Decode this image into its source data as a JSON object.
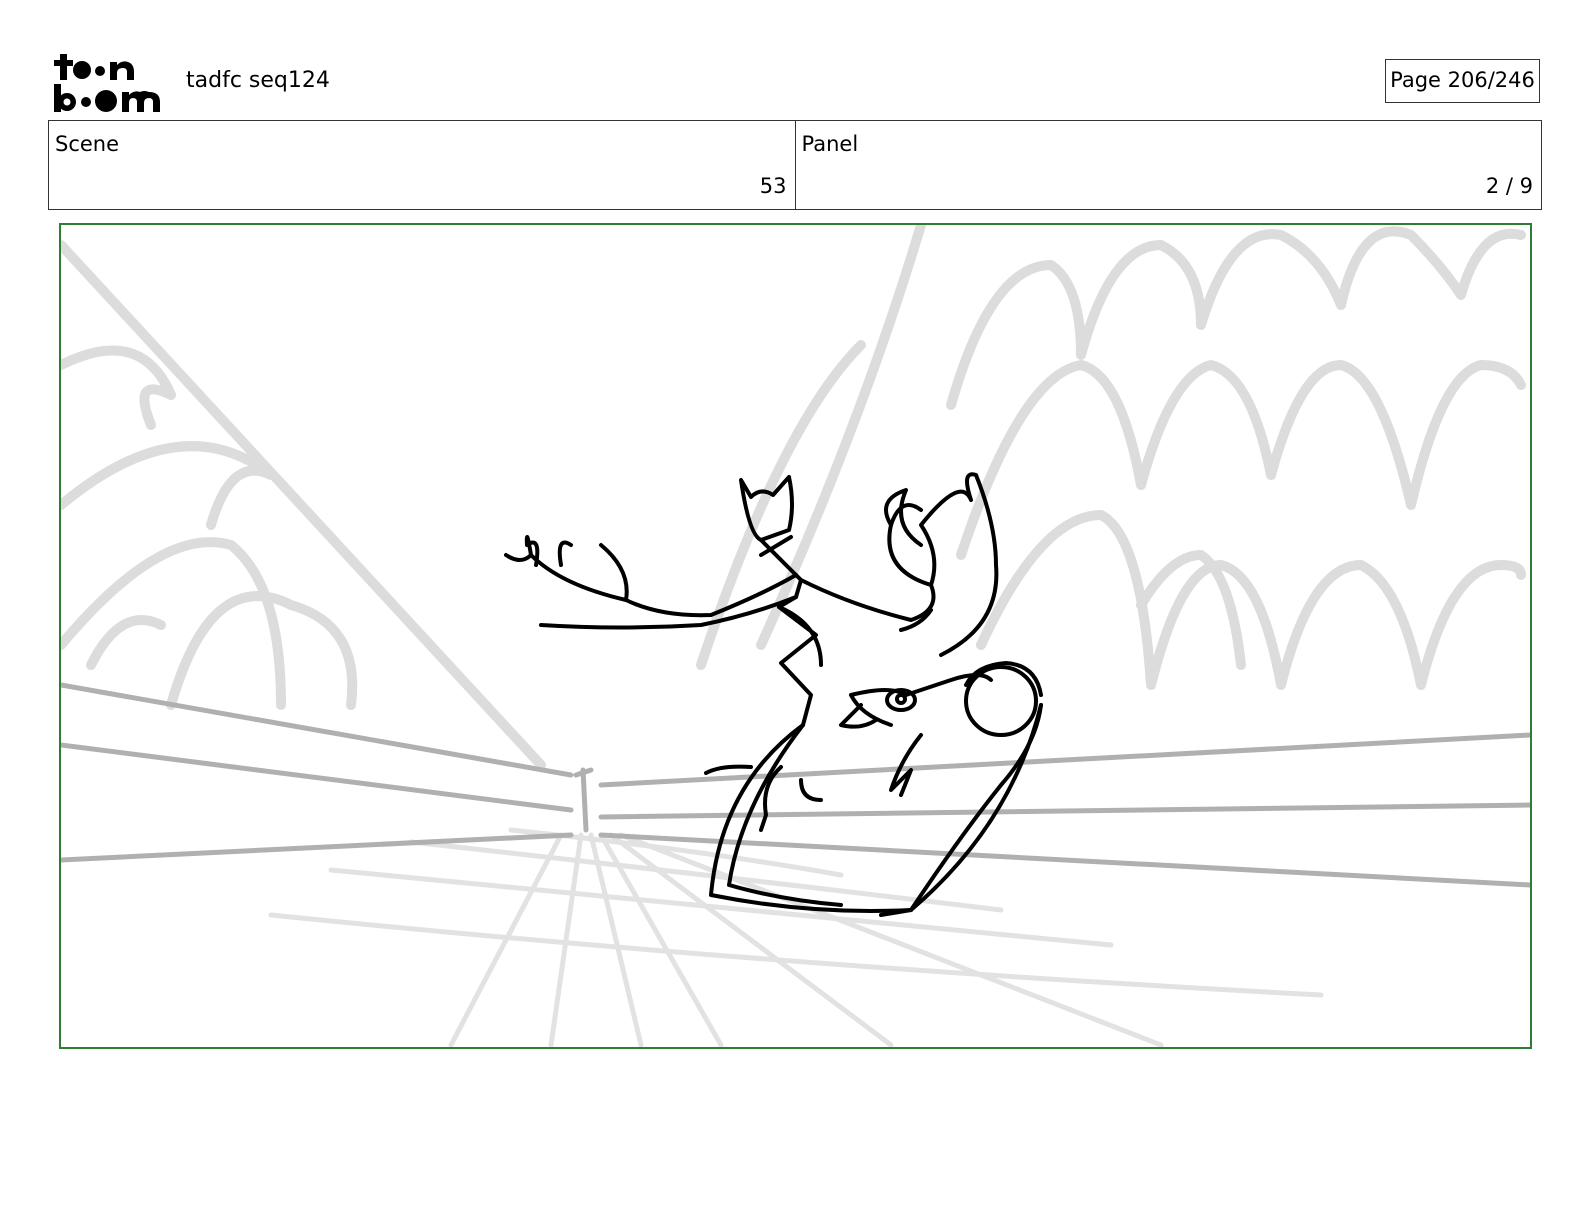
{
  "header": {
    "logo_lines": [
      "toon",
      "boom"
    ],
    "project_title": "tadfc seq124",
    "page_indicator": "Page 206/246"
  },
  "info": {
    "scene_label": "Scene",
    "scene_value": "53",
    "panel_label": "Panel",
    "panel_value": "2 / 9"
  },
  "colors": {
    "frame_border": "#2e7d32",
    "sketch_light": "#dcdcdc",
    "sketch_mid": "#b0b0b0",
    "ink": "#000000"
  }
}
